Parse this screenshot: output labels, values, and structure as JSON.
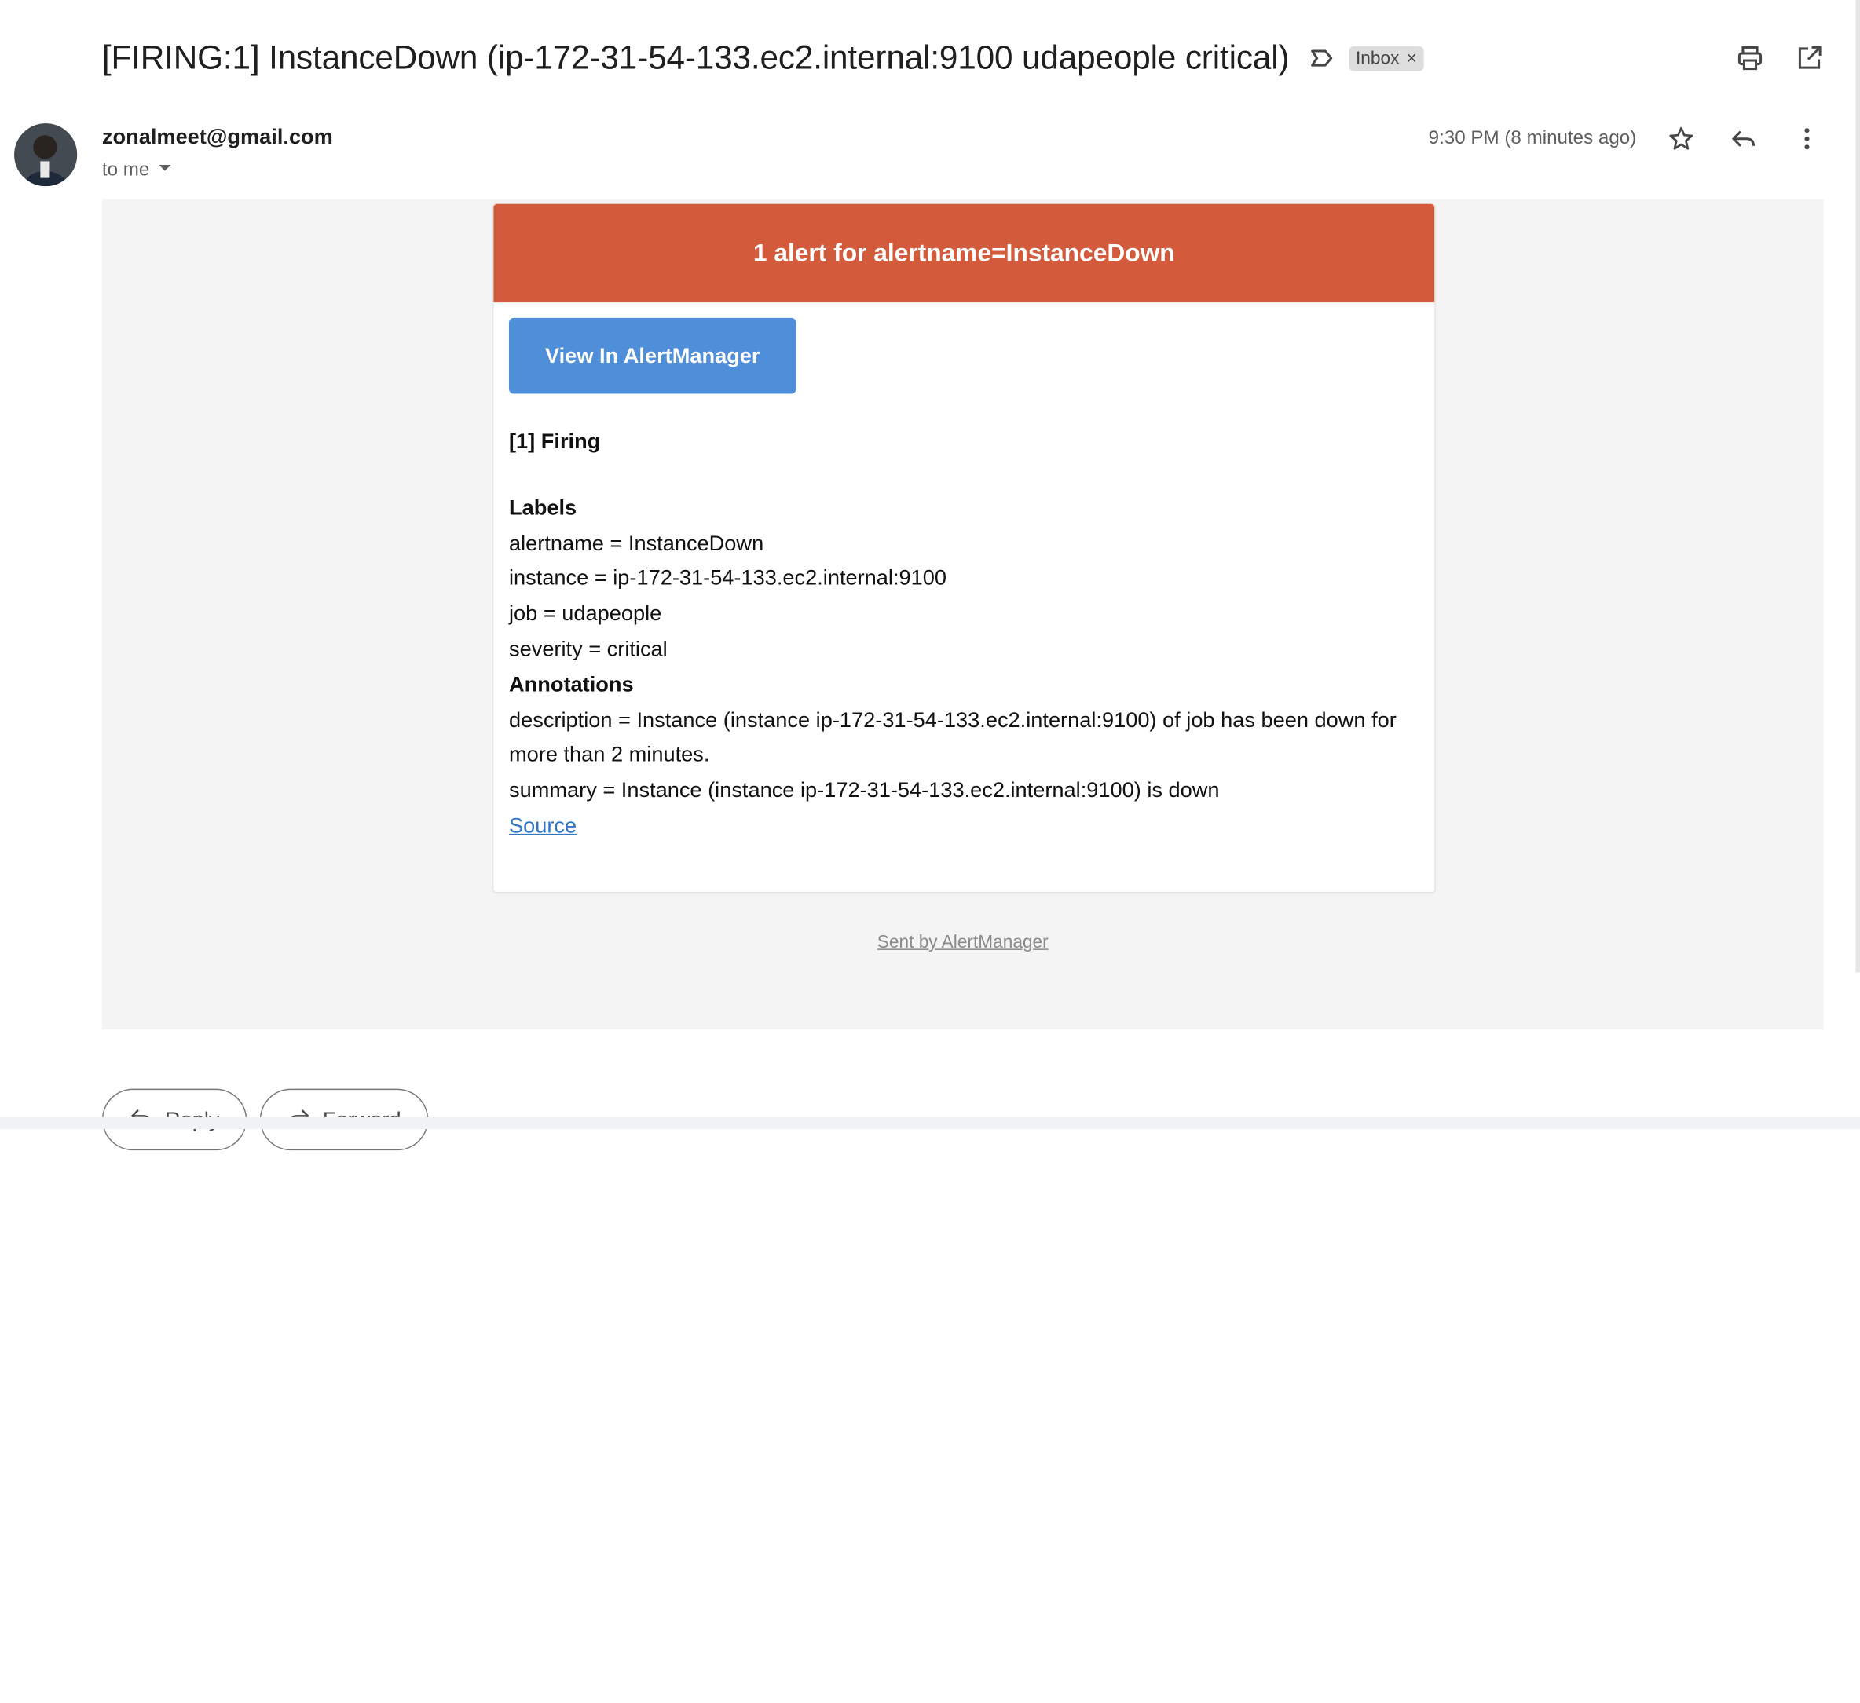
{
  "subject": "[FIRING:1] InstanceDown (ip-172-31-54-133.ec2.internal:9100 udapeople critical)",
  "inbox_chip": {
    "label": "Inbox",
    "close": "×"
  },
  "sender": "zonalmeet@gmail.com",
  "recipient": "to me",
  "time": "9:30 PM (8 minutes ago)",
  "alert_header": "1 alert for alertname=InstanceDown",
  "view_button": "View In AlertManager",
  "firing_title": "[1] Firing",
  "labels_title": "Labels",
  "labels": [
    "alertname = InstanceDown",
    "instance = ip-172-31-54-133.ec2.internal:9100",
    "job = udapeople",
    "severity = critical"
  ],
  "annotations_title": "Annotations",
  "annotations": [
    "description = Instance (instance ip-172-31-54-133.ec2.internal:9100) of job has been down for more than 2 minutes.",
    "summary = Instance (instance ip-172-31-54-133.ec2.internal:9100) is down"
  ],
  "source_link": "Source",
  "sent_by": "Sent by AlertManager",
  "actions": {
    "reply": "Reply",
    "forward": "Forward"
  },
  "colors": {
    "alert_header": "#d35b3b",
    "view_button": "#4f8fd9",
    "link": "#2f76c9"
  },
  "icons": {
    "label": "label-importance-icon",
    "print": "print-icon",
    "open_new": "open-in-new-window-icon",
    "star": "star-icon",
    "reply": "reply-icon",
    "more": "more-vert-icon",
    "dropdown": "caret-down-icon"
  }
}
